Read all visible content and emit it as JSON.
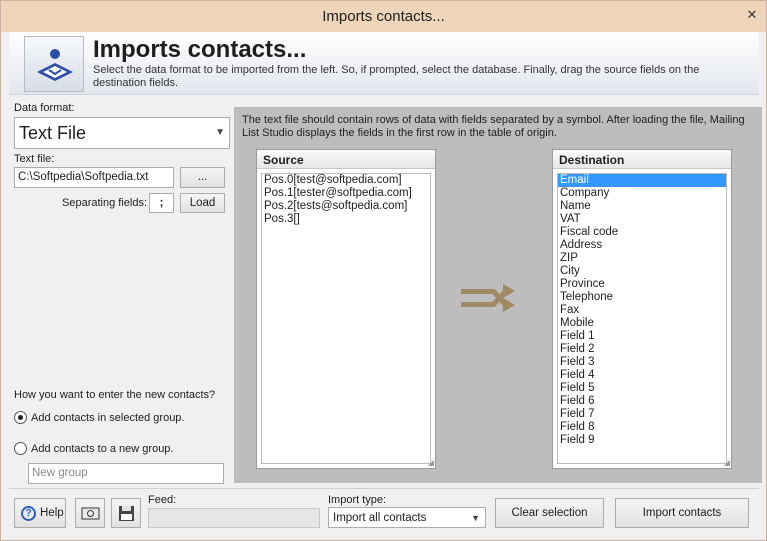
{
  "window": {
    "title": "Imports contacts...",
    "close_glyph": "✕"
  },
  "header": {
    "title": "Imports contacts...",
    "description": "Select the data format to be imported from the left. So, if prompted, select the database. Finally, drag the source fields on the destination fields."
  },
  "left": {
    "data_format_label": "Data format:",
    "data_format_value": "Text File",
    "text_file_label": "Text file:",
    "text_file_value": "C:\\Softpedia\\Softpedia.txt",
    "browse_label": "...",
    "separating_label": "Separating fields:",
    "separator_value": ";",
    "load_label": "Load",
    "question": "How you want to enter the new contacts?",
    "option_selected_group": "Add contacts in selected group.",
    "option_new_group": "Add contacts to a new group.",
    "new_group_placeholder": "New group"
  },
  "main": {
    "info": "The text file should contain rows of data with fields separated by a symbol. After loading the file, Mailing List Studio displays the fields in the first row in the table of origin.",
    "source_title": "Source",
    "source_items": [
      "Pos.0[test@softpedia.com]",
      "Pos.1[tester@softpedia.com]",
      "Pos.2[tests@softpedia.com]",
      "Pos.3[]"
    ],
    "destination_title": "Destination",
    "destination_items": [
      "Email",
      "Company",
      "Name",
      "VAT",
      "Fiscal code",
      "Address",
      "ZIP",
      "City",
      "Province",
      "Telephone",
      "Fax",
      "Mobile",
      "Field 1",
      "Field 2",
      "Field 3",
      "Field 4",
      "Field 5",
      "Field 6",
      "Field 7",
      "Field 8",
      "Field 9"
    ],
    "destination_selected": "Email"
  },
  "bottom": {
    "help_label": "Help",
    "feed_label": "Feed:",
    "import_type_label": "Import type:",
    "import_type_value": "Import all contacts",
    "clear_label": "Clear selection",
    "import_label": "Import contacts"
  },
  "colors": {
    "titlebar": "#eed4b8",
    "selection": "#3399ff",
    "arrow_icon": "#a08a63"
  }
}
